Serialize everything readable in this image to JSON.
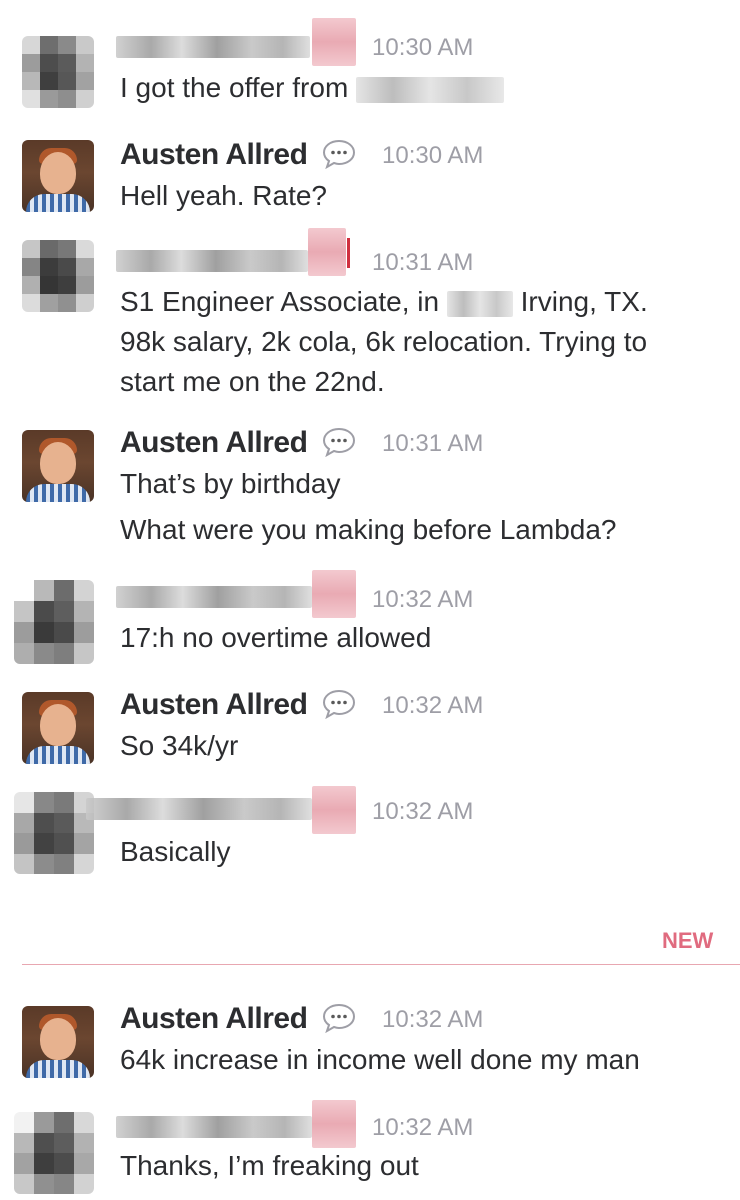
{
  "colors": {
    "timestamp": "#9e9ea6",
    "new_divider": "#e8a7b1",
    "new_label": "#e06b7f"
  },
  "messages": [
    {
      "author": "",
      "time": "10:30 AM",
      "lines": [
        "I got the offer from"
      ]
    },
    {
      "author": "Austen Allred",
      "time": "10:30 AM",
      "lines": [
        "Hell yeah. Rate?"
      ]
    },
    {
      "author": "",
      "time": "10:31 AM",
      "lines": [
        "S1 Engineer Associate, in",
        "Irving, TX.",
        "98k salary, 2k cola, 6k relocation. Trying to",
        "start me on the 22nd."
      ]
    },
    {
      "author": "Austen Allred",
      "time": "10:31 AM",
      "lines": [
        "That’s by birthday",
        "What were you making before Lambda?"
      ]
    },
    {
      "author": "",
      "time": "10:32 AM",
      "lines": [
        "17:h no overtime allowed"
      ]
    },
    {
      "author": "Austen Allred",
      "time": "10:32 AM",
      "lines": [
        "So 34k/yr"
      ]
    },
    {
      "author": "",
      "time": "10:32 AM",
      "lines": [
        "Basically"
      ]
    },
    {
      "author": "Austen Allred",
      "time": "10:32 AM",
      "lines": [
        "64k increase in income well done my man"
      ]
    },
    {
      "author": "",
      "time": "10:32 AM",
      "lines": [
        "Thanks, I’m freaking out"
      ]
    }
  ],
  "divider": {
    "label": "NEW"
  }
}
